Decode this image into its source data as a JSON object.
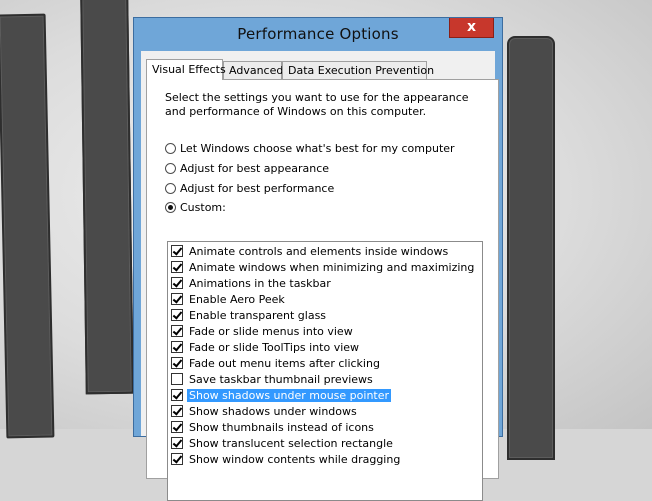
{
  "window": {
    "title": "Performance Options",
    "close_glyph": "x",
    "title_bar_color": "#6fa6d8"
  },
  "tabs": [
    {
      "label": "Visual Effects",
      "active": true
    },
    {
      "label": "Advanced",
      "active": false
    },
    {
      "label": "Data Execution Prevention",
      "active": false
    }
  ],
  "description": "Select the settings you want to use for the appearance and performance of Windows on this computer.",
  "radios": [
    {
      "label": "Let Windows choose what's best for my computer",
      "selected": false
    },
    {
      "label": "Adjust for best appearance",
      "selected": false
    },
    {
      "label": "Adjust for best performance",
      "selected": false
    },
    {
      "label": "Custom:",
      "selected": true
    }
  ],
  "effects": [
    {
      "label": "Animate controls and elements inside windows",
      "checked": true
    },
    {
      "label": "Animate windows when minimizing and maximizing",
      "checked": true
    },
    {
      "label": "Animations in the taskbar",
      "checked": true
    },
    {
      "label": "Enable Aero Peek",
      "checked": true
    },
    {
      "label": "Enable transparent glass",
      "checked": true
    },
    {
      "label": "Fade or slide menus into view",
      "checked": true
    },
    {
      "label": "Fade or slide ToolTips into view",
      "checked": true
    },
    {
      "label": "Fade out menu items after clicking",
      "checked": true
    },
    {
      "label": "Save taskbar thumbnail previews",
      "checked": false
    },
    {
      "label": "Show shadows under mouse pointer",
      "checked": true,
      "highlighted": true
    },
    {
      "label": "Show shadows under windows",
      "checked": true
    },
    {
      "label": "Show thumbnails instead of icons",
      "checked": true
    },
    {
      "label": "Show translucent selection rectangle",
      "checked": true
    },
    {
      "label": "Show window contents while dragging",
      "checked": true
    }
  ],
  "colors": {
    "selection": "#3399ff",
    "close_button": "#c7372c"
  },
  "icons": [
    "close-icon"
  ]
}
